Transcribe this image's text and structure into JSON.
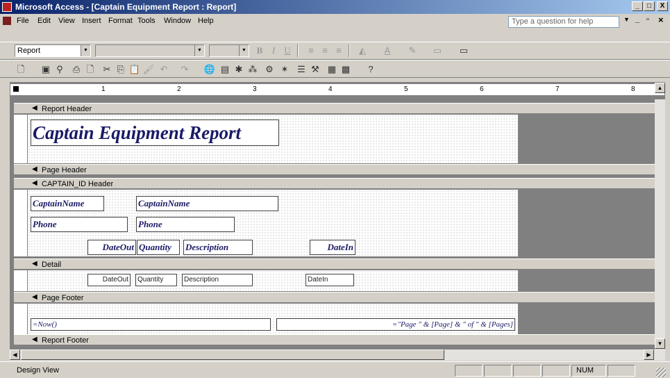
{
  "window": {
    "title": "Microsoft Access - [Captain Equipment Report : Report]",
    "min_label": "_",
    "max_label": "□",
    "close_label": "X"
  },
  "menu": {
    "items": [
      "File",
      "Edit",
      "View",
      "Insert",
      "Format",
      "Tools",
      "Window",
      "Help"
    ],
    "help_placeholder": "Type a question for help",
    "doc_min": "_",
    "doc_restore": "▫",
    "doc_close": "×"
  },
  "format_toolbar": {
    "object_combo": "Report",
    "font_combo": "",
    "size_combo": "",
    "bold": "B",
    "italic": "I",
    "underline": "U"
  },
  "ruler": {
    "marks": [
      "1",
      "2",
      "3",
      "4",
      "5",
      "6",
      "7",
      "8"
    ]
  },
  "sections": {
    "report_header": "Report Header",
    "page_header": "Page Header",
    "group_header": "CAPTAIN_ID Header",
    "detail": "Detail",
    "page_footer": "Page Footer",
    "report_footer": "Report Footer"
  },
  "report_header": {
    "title": "Captain Equipment Report"
  },
  "group_header": {
    "captain_label": "CaptainName",
    "captain_field": "CaptainName",
    "phone_label": "Phone",
    "phone_field": "Phone",
    "col_dateout": "DateOut",
    "col_quantity": "Quantity",
    "col_description": "Description",
    "col_datein": "DateIn"
  },
  "detail": {
    "dateout": "DateOut",
    "quantity": "Quantity",
    "description": "Description",
    "datein": "DateIn"
  },
  "page_footer": {
    "now_expr": "=Now()",
    "page_expr": "=\"Page \" & [Page] & \" of \" & [Pages]"
  },
  "status": {
    "mode": "Design View",
    "num": "NUM"
  }
}
